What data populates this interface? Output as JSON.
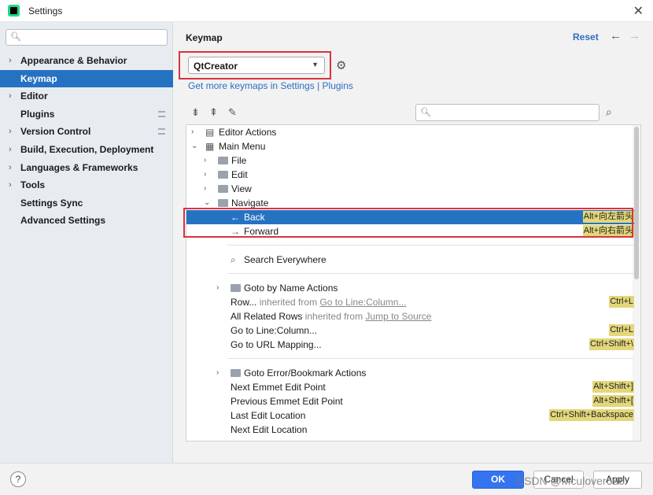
{
  "window": {
    "title": "Settings"
  },
  "sidebar": {
    "search_placeholder": "",
    "items": [
      {
        "label": "Appearance & Behavior",
        "chevron": true,
        "selected": false
      },
      {
        "label": "Keymap",
        "chevron": false,
        "selected": true
      },
      {
        "label": "Editor",
        "chevron": true,
        "selected": false
      },
      {
        "label": "Plugins",
        "chevron": false,
        "selected": false
      },
      {
        "label": "Version Control",
        "chevron": true,
        "selected": false
      },
      {
        "label": "Build, Execution, Deployment",
        "chevron": true,
        "selected": false
      },
      {
        "label": "Languages & Frameworks",
        "chevron": true,
        "selected": false
      },
      {
        "label": "Tools",
        "chevron": true,
        "selected": false
      },
      {
        "label": "Settings Sync",
        "chevron": false,
        "selected": false
      },
      {
        "label": "Advanced Settings",
        "chevron": false,
        "selected": false
      }
    ]
  },
  "main": {
    "title": "Keymap",
    "reset_label": "Reset",
    "keymap_value": "QtCreator",
    "more_keymaps_link": "Get more keymaps in Settings | Plugins"
  },
  "tree": {
    "rows": [
      {
        "label": "Editor Actions",
        "chevron": ">",
        "icon": "editor-actions-icon"
      },
      {
        "label": "Main Menu",
        "chevron": "v",
        "icon": "main-menu-icon"
      },
      {
        "label": "File",
        "chevron": ">",
        "icon": "folder-icon"
      },
      {
        "label": "Edit",
        "chevron": ">",
        "icon": "folder-icon"
      },
      {
        "label": "View",
        "chevron": ">",
        "icon": "folder-icon"
      },
      {
        "label": "Navigate",
        "chevron": "v",
        "icon": "folder-icon"
      },
      {
        "label": "Back",
        "icon": "arrow-left-icon",
        "shortcut": "Alt+向左箭头",
        "selected": true
      },
      {
        "label": "Forward",
        "icon": "arrow-right-icon",
        "shortcut": "Alt+向右箭头",
        "selected": false
      },
      {
        "label": "Search Everywhere",
        "icon": "search-icon"
      },
      {
        "label": "Goto by Name Actions",
        "chevron": ">",
        "icon": "folder-icon"
      },
      {
        "label": "Row...",
        "inherited": " inherited from ",
        "link": "Go to Line:Column...",
        "shortcut": "Ctrl+L"
      },
      {
        "label": "All Related Rows",
        "inherited": " inherited from ",
        "link": "Jump to Source"
      },
      {
        "label": "Go to Line:Column...",
        "shortcut": "Ctrl+L"
      },
      {
        "label": "Go to URL Mapping...",
        "shortcut": "Ctrl+Shift+\\"
      },
      {
        "label": "Goto Error/Bookmark Actions",
        "chevron": ">",
        "icon": "folder-icon"
      },
      {
        "label": "Next Emmet Edit Point",
        "shortcut": "Alt+Shift+]"
      },
      {
        "label": "Previous Emmet Edit Point",
        "shortcut": "Alt+Shift+["
      },
      {
        "label": "Last Edit Location",
        "shortcut": "Ctrl+Shift+Backspace"
      },
      {
        "label": "Next Edit Location"
      }
    ]
  },
  "footer": {
    "help": "?",
    "ok_label": "OK",
    "cancel_label": "Cancel",
    "apply_label": "Apply",
    "watermark": "CSDN @Mculover666"
  },
  "colors": {
    "accent": "#2672c2",
    "link": "#2d6fc0",
    "highlight_box": "#d9333f",
    "shortcut_bg": "#e3d77a"
  }
}
